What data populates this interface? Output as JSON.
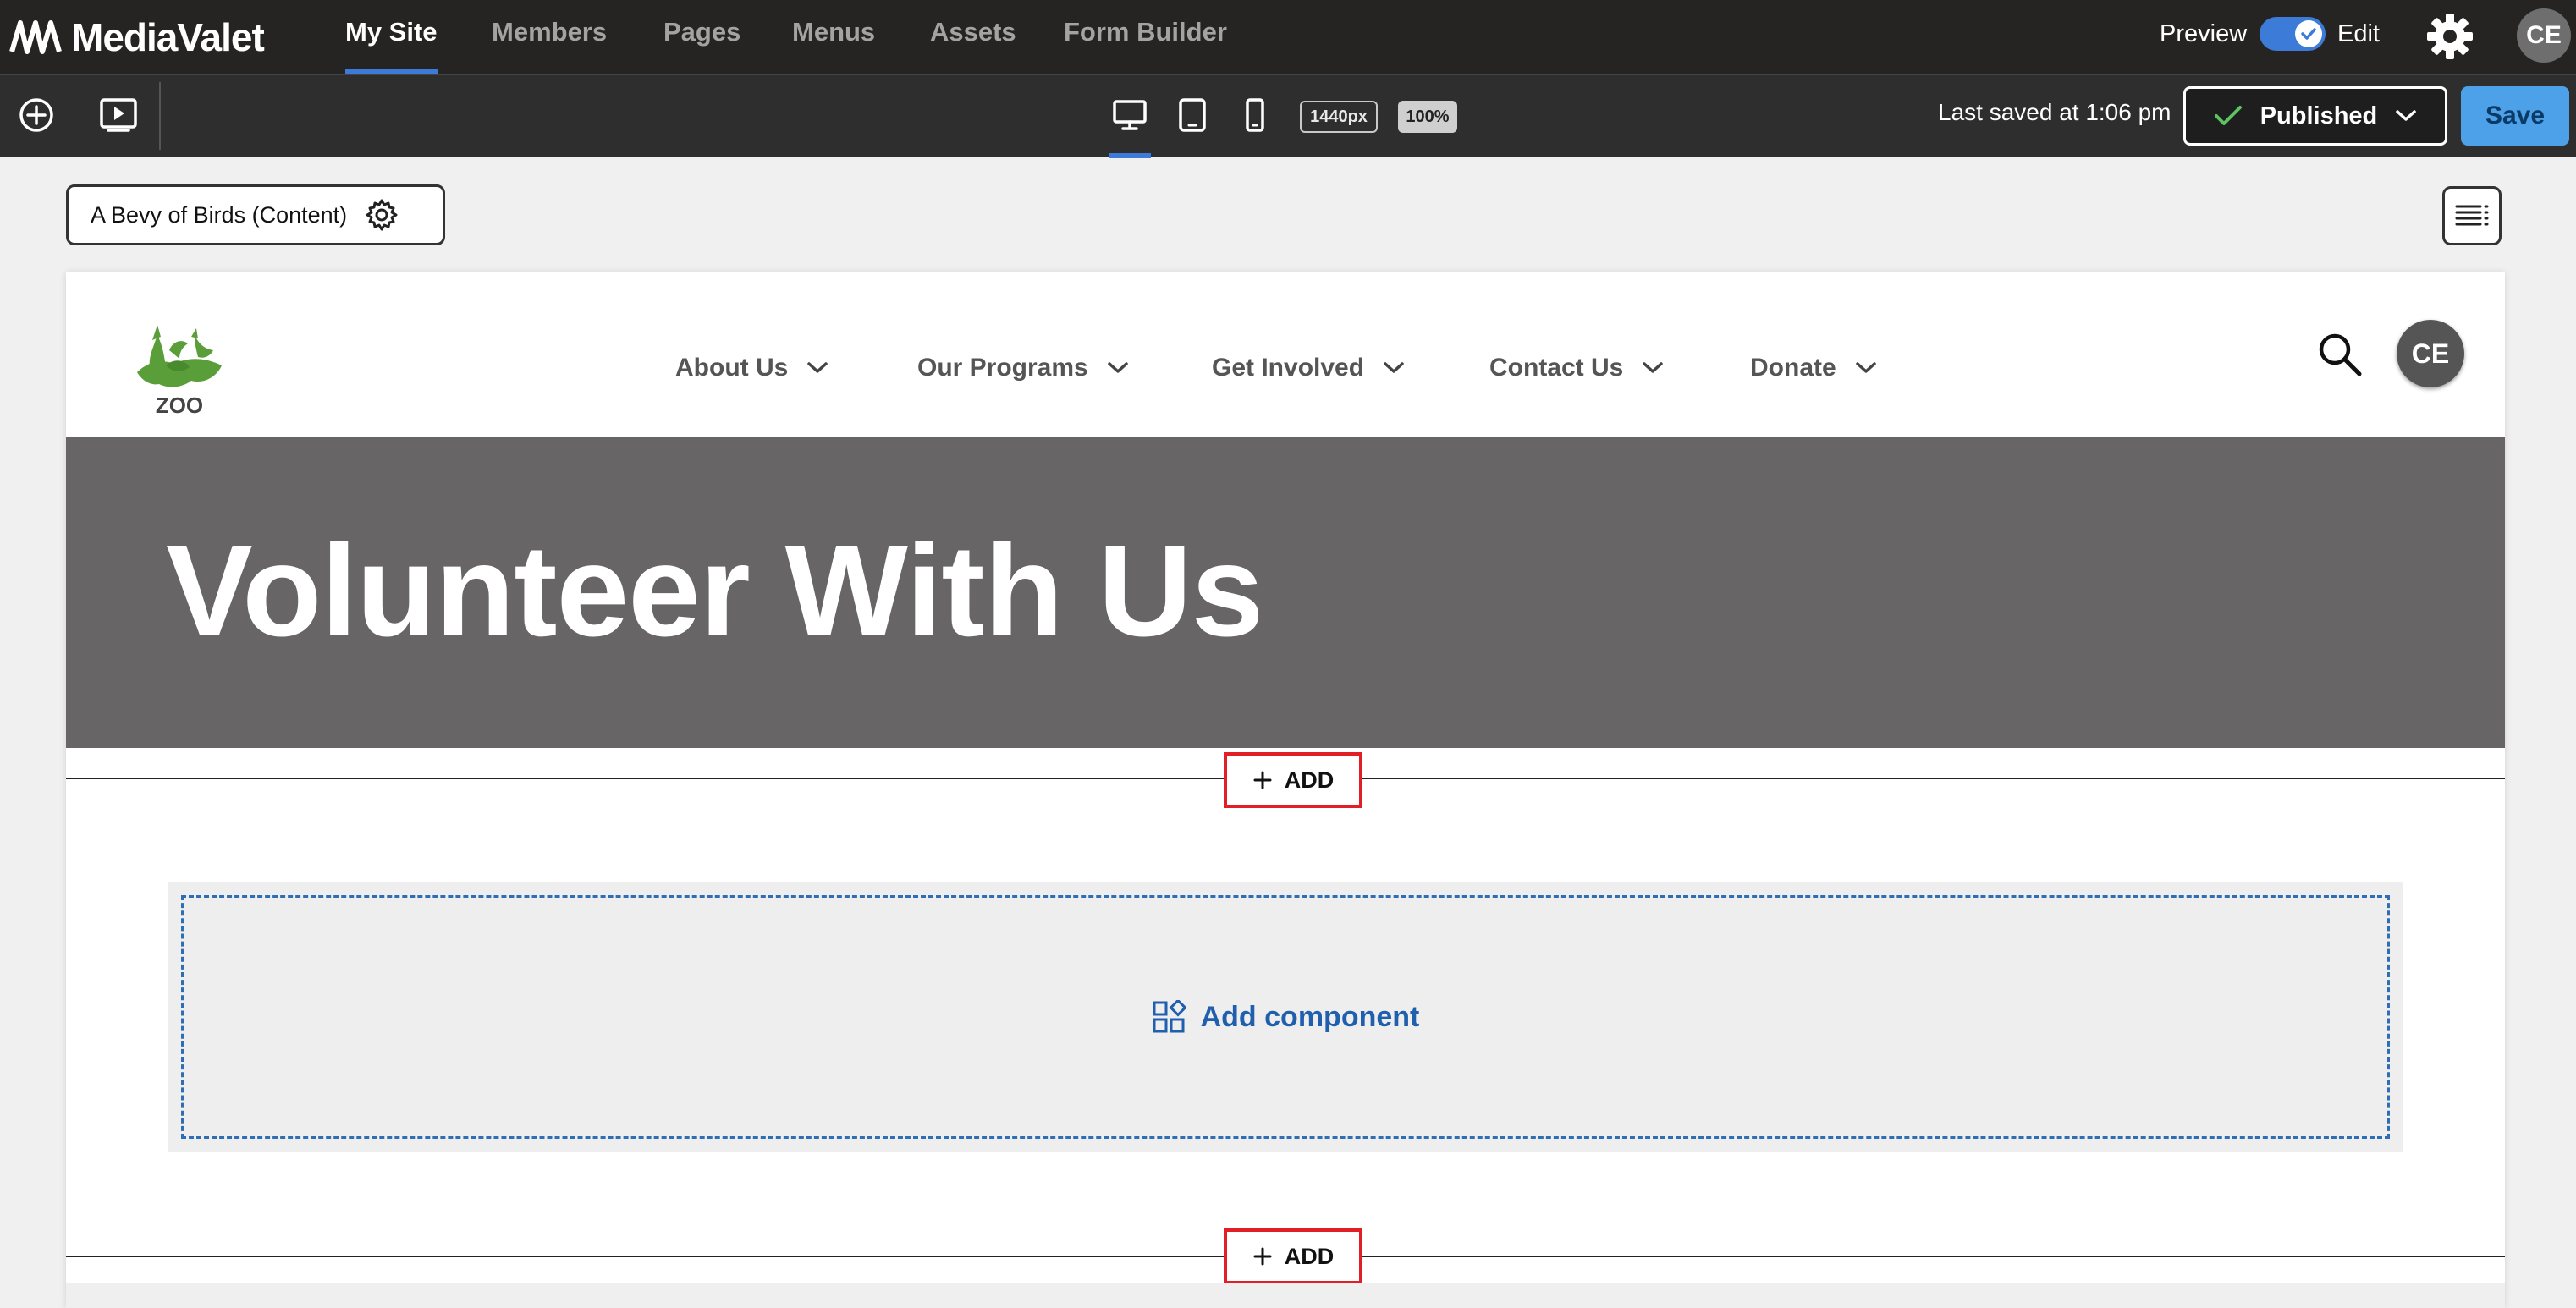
{
  "app": {
    "brand": "MediaValet",
    "nav": [
      "My Site",
      "Members",
      "Pages",
      "Menus",
      "Assets",
      "Form Builder"
    ],
    "active_nav": "My Site",
    "mode": {
      "preview_label": "Preview",
      "edit_label": "Edit",
      "edit_enabled": true
    },
    "user_initials": "CE"
  },
  "toolbar": {
    "width_label": "1440px",
    "zoom_label": "100%",
    "active_device": "desktop",
    "last_saved": "Last saved at 1:06 pm",
    "status_label": "Published",
    "save_label": "Save"
  },
  "editor": {
    "page_name": "A Bevy of Birds (Content)",
    "add_label": "ADD",
    "add_component_label": "Add component"
  },
  "site": {
    "logo_text": "ZOO",
    "nav": [
      "About Us",
      "Our Programs",
      "Get Involved",
      "Contact Us",
      "Donate"
    ],
    "user_initials": "CE",
    "hero_title": "Volunteer With Us"
  },
  "colors": {
    "accent": "#3d7bd9",
    "save_button": "#4da1e8",
    "hero_bg": "#686566",
    "highlight_border": "#e21f26",
    "dropzone_border": "#2f6db5",
    "logo_green": "#5a9e3a"
  }
}
